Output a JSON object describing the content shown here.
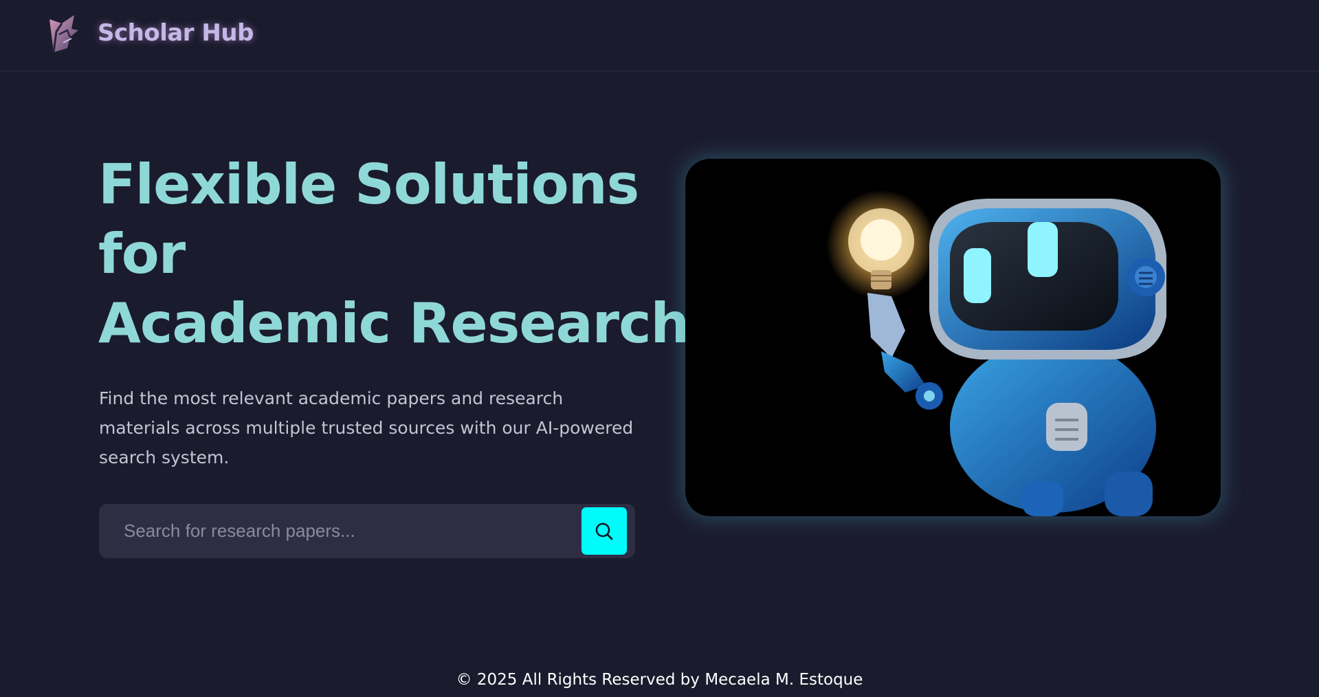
{
  "header": {
    "brand": "Scholar Hub",
    "logo_icon": "shield-logo-icon"
  },
  "hero": {
    "title_line1": "Flexible Solutions",
    "title_line2": "for",
    "title_line3": "Academic Research",
    "description": "Find the most relevant academic papers and research materials across multiple trusted sources with our AI-powered search system."
  },
  "search": {
    "placeholder": "Search for research papers...",
    "value": "",
    "button_icon": "search-icon"
  },
  "image": {
    "subject": "robot-with-lightbulb"
  },
  "footer": {
    "text": "© 2025 All Rights Reserved by Mecaela M. Estoque"
  },
  "colors": {
    "background": "#1b1b2e",
    "accent": "#00fbfb",
    "title": "#8fd8d8",
    "brand": "#c4b8e8",
    "search_bg": "#2e2d44"
  }
}
